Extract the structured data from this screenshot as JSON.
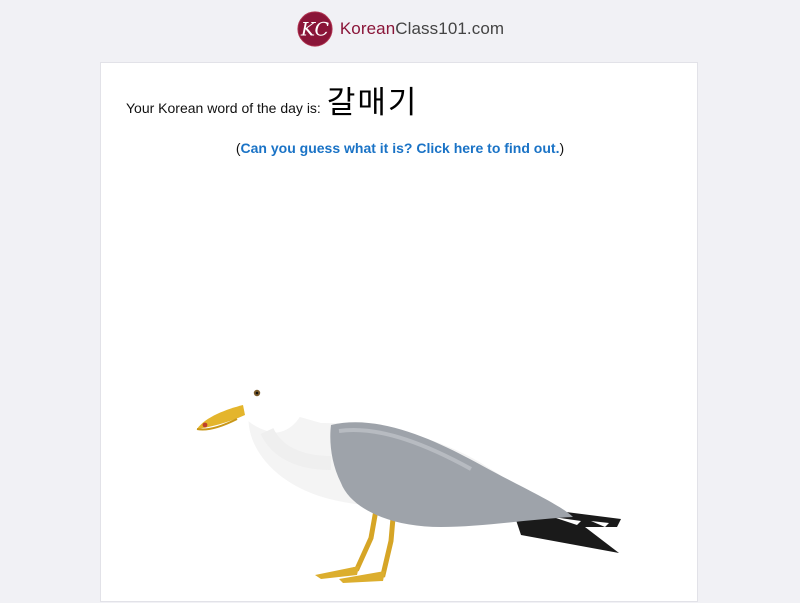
{
  "header": {
    "logo_brand": "Korean",
    "logo_rest": "Class101.com",
    "logo_mark_text": "KC"
  },
  "word": {
    "intro": "Your Korean word of the day is:",
    "korean": "갈매기"
  },
  "hint": {
    "open_paren": "(",
    "link_text": "Can you guess what it is? Click here to find out.",
    "close_paren": ")"
  },
  "colors": {
    "brand": "#8a1538",
    "link": "#1a73c6",
    "page_background": "#f1f1f5"
  },
  "image": {
    "subject": "seagull"
  }
}
